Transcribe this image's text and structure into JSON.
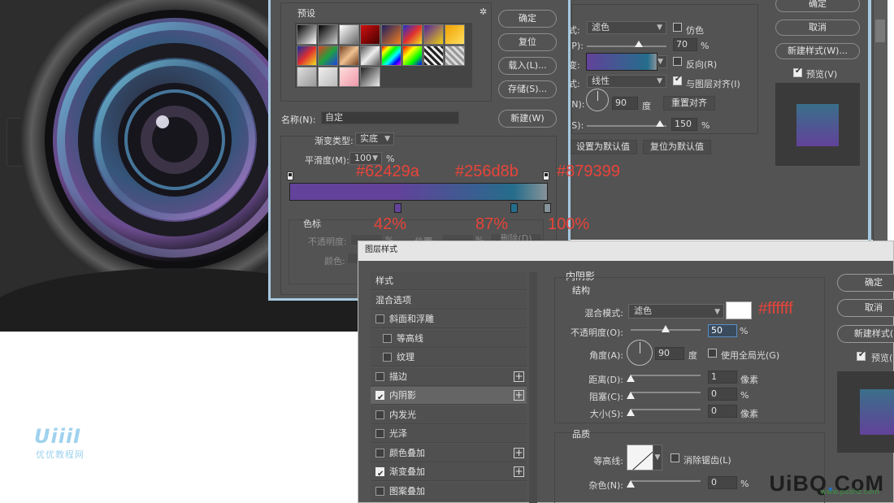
{
  "watermark_left": {
    "logo": "UiiiI",
    "site": "优优教程网"
  },
  "gradient_editor": {
    "presets_title": "预设",
    "buttons": {
      "ok": "确定",
      "reset": "复位",
      "load": "载入(L)...",
      "save": "存储(S)...",
      "new": "新建(W)"
    },
    "name_label": "名称(N):",
    "name_value": "自定",
    "type_label": "渐变类型:",
    "type_value": "实底",
    "smoothness_label": "平滑度(M):",
    "smoothness_value": "100",
    "smoothness_unit": "%",
    "color_stops_label": "色标",
    "stop_opacity_label": "不透明度:",
    "stop_pct": "%",
    "stop_location_label": "位置:",
    "stop_pct2": "%",
    "delete_label": "删除(D)",
    "stop_color_label": "颜色:",
    "stops": [
      {
        "color": "#62429a",
        "location_percent": 42
      },
      {
        "color": "#256d8b",
        "location_percent": 87
      },
      {
        "color": "#879399",
        "location_percent": 100
      }
    ]
  },
  "annotations": {
    "stop1_hex": "#62429a",
    "stop2_hex": "#256d8b",
    "stop3_hex": "#879399",
    "stop1_pct": "42%",
    "stop2_pct": "87%",
    "stop3_pct": "100%",
    "shadow_hex": "#ffffff"
  },
  "gradient_overlay_panel": {
    "blend_label": "式:",
    "blend_value": "滤色",
    "dither_label": "仿色",
    "opacity_label": "(P):",
    "opacity_value": "70",
    "opacity_unit": "%",
    "gradient_label": "变:",
    "reverse_label": "反向(R)",
    "style_label": "式:",
    "style_value": "线性",
    "align_label": "与图层对齐(I)",
    "angle_label": "(N):",
    "angle_value": "90",
    "angle_unit": "度",
    "reset_align": "重置对齐",
    "scale_label": "(S):",
    "scale_value": "150",
    "scale_unit": "%",
    "make_default": "设置为默认值",
    "reset_default": "复位为默认值",
    "right_buttons": {
      "ok": "确定",
      "cancel": "取消",
      "new_style": "新建样式(W)...",
      "preview": "预览(V)"
    }
  },
  "layer_style_dialog": {
    "title": "图层样式",
    "list": [
      {
        "label": "样式",
        "checkbox": false,
        "checked": false,
        "plus": false,
        "indent": false
      },
      {
        "label": "混合选项",
        "checkbox": false,
        "checked": false,
        "plus": false,
        "indent": false
      },
      {
        "label": "斜面和浮雕",
        "checkbox": true,
        "checked": false,
        "plus": false,
        "indent": false
      },
      {
        "label": "等高线",
        "checkbox": true,
        "checked": false,
        "plus": false,
        "indent": true
      },
      {
        "label": "纹理",
        "checkbox": true,
        "checked": false,
        "plus": false,
        "indent": true
      },
      {
        "label": "描边",
        "checkbox": true,
        "checked": false,
        "plus": true,
        "indent": false
      },
      {
        "label": "内阴影",
        "checkbox": true,
        "checked": true,
        "plus": true,
        "indent": false,
        "selected": true
      },
      {
        "label": "内发光",
        "checkbox": true,
        "checked": false,
        "plus": false,
        "indent": false
      },
      {
        "label": "光泽",
        "checkbox": true,
        "checked": false,
        "plus": false,
        "indent": false
      },
      {
        "label": "颜色叠加",
        "checkbox": true,
        "checked": false,
        "plus": true,
        "indent": false
      },
      {
        "label": "渐变叠加",
        "checkbox": true,
        "checked": true,
        "plus": true,
        "indent": false
      },
      {
        "label": "图案叠加",
        "checkbox": true,
        "checked": false,
        "plus": false,
        "indent": false
      }
    ],
    "section_title": "内阴影",
    "structure_title": "结构",
    "blend_label": "混合模式:",
    "blend_value": "滤色",
    "shadow_color": "#ffffff",
    "opacity_label": "不透明度(O):",
    "opacity_value": "50",
    "opacity_unit": "%",
    "angle_label": "角度(A):",
    "angle_value": "90",
    "angle_unit": "度",
    "global_light_label": "使用全局光(G)",
    "distance_label": "距离(D):",
    "distance_value": "1",
    "distance_unit": "像素",
    "choke_label": "阻塞(C):",
    "choke_value": "0",
    "choke_unit": "%",
    "size_label": "大小(S):",
    "size_value": "0",
    "size_unit": "像素",
    "quality_title": "品质",
    "contour_label": "等高线:",
    "antialias_label": "消除锯齿(L)",
    "noise_label": "杂色(N):",
    "noise_value": "0",
    "noise_unit": "%",
    "buttons": {
      "ok": "确定",
      "cancel": "取消",
      "new_style": "新建样式(",
      "preview": "预览("
    }
  },
  "watermark_right": {
    "brand_a": "UiBQ",
    "brand_dot": ".",
    "brand_b": "CoM",
    "small": "www.psahz.com"
  }
}
